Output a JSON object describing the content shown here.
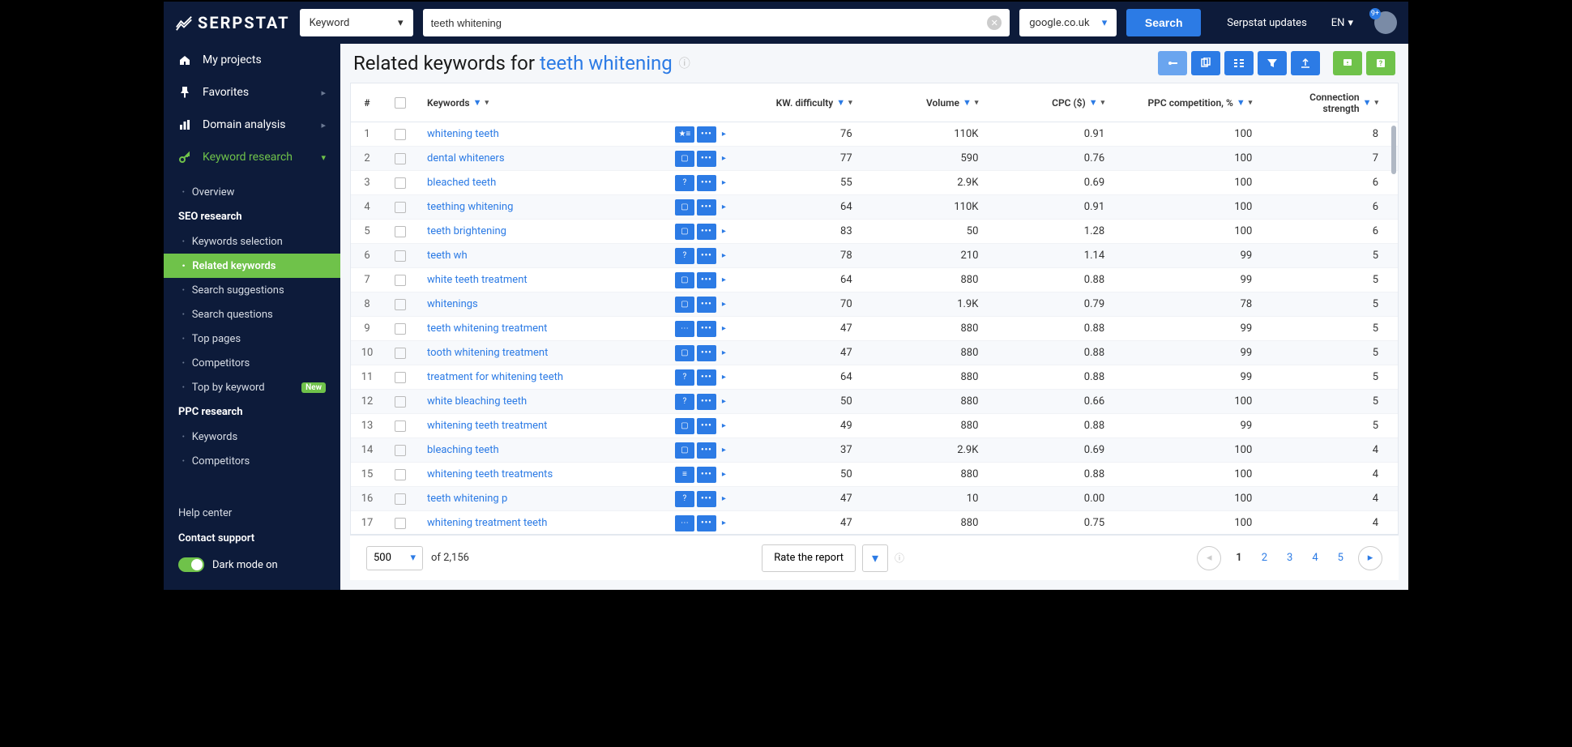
{
  "brand": "SERPSTAT",
  "header": {
    "search_type": "Keyword",
    "search_value": "teeth whitening",
    "engine": "google.co.uk",
    "search_btn": "Search",
    "updates": "Serpstat updates",
    "lang": "EN",
    "avatar_badge": "9+"
  },
  "sidebar": {
    "main": [
      {
        "icon": "home",
        "label": "My projects"
      },
      {
        "icon": "pin",
        "label": "Favorites",
        "chev": true
      },
      {
        "icon": "bars",
        "label": "Domain analysis",
        "chev": true
      },
      {
        "icon": "key",
        "label": "Keyword research",
        "chev": true,
        "active": true
      }
    ],
    "overview": "Overview",
    "seo_header": "SEO research",
    "seo_items": [
      {
        "label": "Keywords selection"
      },
      {
        "label": "Related keywords",
        "selected": true
      },
      {
        "label": "Search suggestions"
      },
      {
        "label": "Search questions"
      },
      {
        "label": "Top pages"
      },
      {
        "label": "Competitors"
      },
      {
        "label": "Top by keyword",
        "badge": "New"
      }
    ],
    "ppc_header": "PPC research",
    "ppc_items": [
      {
        "label": "Keywords"
      },
      {
        "label": "Competitors"
      }
    ],
    "help": "Help center",
    "contact": "Contact support",
    "dark_mode": "Dark mode on"
  },
  "page": {
    "title_prefix": "Related keywords for ",
    "title_kw": "teeth whitening"
  },
  "columns": {
    "num": "#",
    "kw": "Keywords",
    "diff": "KW. difficulty",
    "vol": "Volume",
    "cpc": "CPC ($)",
    "ppc": "PPC competition, %",
    "conn": "Connection strength"
  },
  "rows": [
    {
      "n": 1,
      "kw": "whitening teeth",
      "icon": "star",
      "diff": 76,
      "vol": "110K",
      "cpc": "0.91",
      "ppc": 100,
      "conn": 8
    },
    {
      "n": 2,
      "kw": "dental whiteners",
      "icon": "img",
      "diff": 77,
      "vol": "590",
      "cpc": "0.76",
      "ppc": 100,
      "conn": 7
    },
    {
      "n": 3,
      "kw": "bleached teeth",
      "icon": "q",
      "diff": 55,
      "vol": "2.9K",
      "cpc": "0.69",
      "ppc": 100,
      "conn": 6
    },
    {
      "n": 4,
      "kw": "teething whitening",
      "icon": "img",
      "diff": 64,
      "vol": "110K",
      "cpc": "0.91",
      "ppc": 100,
      "conn": 6
    },
    {
      "n": 5,
      "kw": "teeth brightening",
      "icon": "img",
      "diff": 83,
      "vol": "50",
      "cpc": "1.28",
      "ppc": 100,
      "conn": 6
    },
    {
      "n": 6,
      "kw": "teeth wh",
      "icon": "q",
      "diff": 78,
      "vol": "210",
      "cpc": "1.14",
      "ppc": 99,
      "conn": 5
    },
    {
      "n": 7,
      "kw": "white teeth treatment",
      "icon": "img",
      "diff": 64,
      "vol": "880",
      "cpc": "0.88",
      "ppc": 99,
      "conn": 5
    },
    {
      "n": 8,
      "kw": "whitenings",
      "icon": "img",
      "diff": 70,
      "vol": "1.9K",
      "cpc": "0.79",
      "ppc": 78,
      "conn": 5
    },
    {
      "n": 9,
      "kw": "teeth whitening treatment",
      "icon": "chat",
      "diff": 47,
      "vol": "880",
      "cpc": "0.88",
      "ppc": 99,
      "conn": 5
    },
    {
      "n": 10,
      "kw": "tooth whitening treatment",
      "icon": "img",
      "diff": 47,
      "vol": "880",
      "cpc": "0.88",
      "ppc": 99,
      "conn": 5
    },
    {
      "n": 11,
      "kw": "treatment for whitening teeth",
      "icon": "q",
      "diff": 64,
      "vol": "880",
      "cpc": "0.88",
      "ppc": 99,
      "conn": 5
    },
    {
      "n": 12,
      "kw": "white bleaching teeth",
      "icon": "q",
      "diff": 50,
      "vol": "880",
      "cpc": "0.66",
      "ppc": 100,
      "conn": 5
    },
    {
      "n": 13,
      "kw": "whitening teeth treatment",
      "icon": "img",
      "diff": 49,
      "vol": "880",
      "cpc": "0.88",
      "ppc": 99,
      "conn": 5
    },
    {
      "n": 14,
      "kw": "bleaching teeth",
      "icon": "img",
      "diff": 37,
      "vol": "2.9K",
      "cpc": "0.69",
      "ppc": 100,
      "conn": 4
    },
    {
      "n": 15,
      "kw": "whitening teeth treatments",
      "icon": "lines",
      "diff": 50,
      "vol": "880",
      "cpc": "0.88",
      "ppc": 100,
      "conn": 4
    },
    {
      "n": 16,
      "kw": "teeth whitening p",
      "icon": "q",
      "diff": 47,
      "vol": "10",
      "cpc": "0.00",
      "ppc": 100,
      "conn": 4
    },
    {
      "n": 17,
      "kw": "whitening treatment teeth",
      "icon": "chat",
      "diff": 47,
      "vol": "880",
      "cpc": "0.75",
      "ppc": 100,
      "conn": 4
    }
  ],
  "footer": {
    "per_page": "500",
    "of": "of 2,156",
    "rate": "Rate the report",
    "pages": [
      "1",
      "2",
      "3",
      "4",
      "5"
    ]
  }
}
